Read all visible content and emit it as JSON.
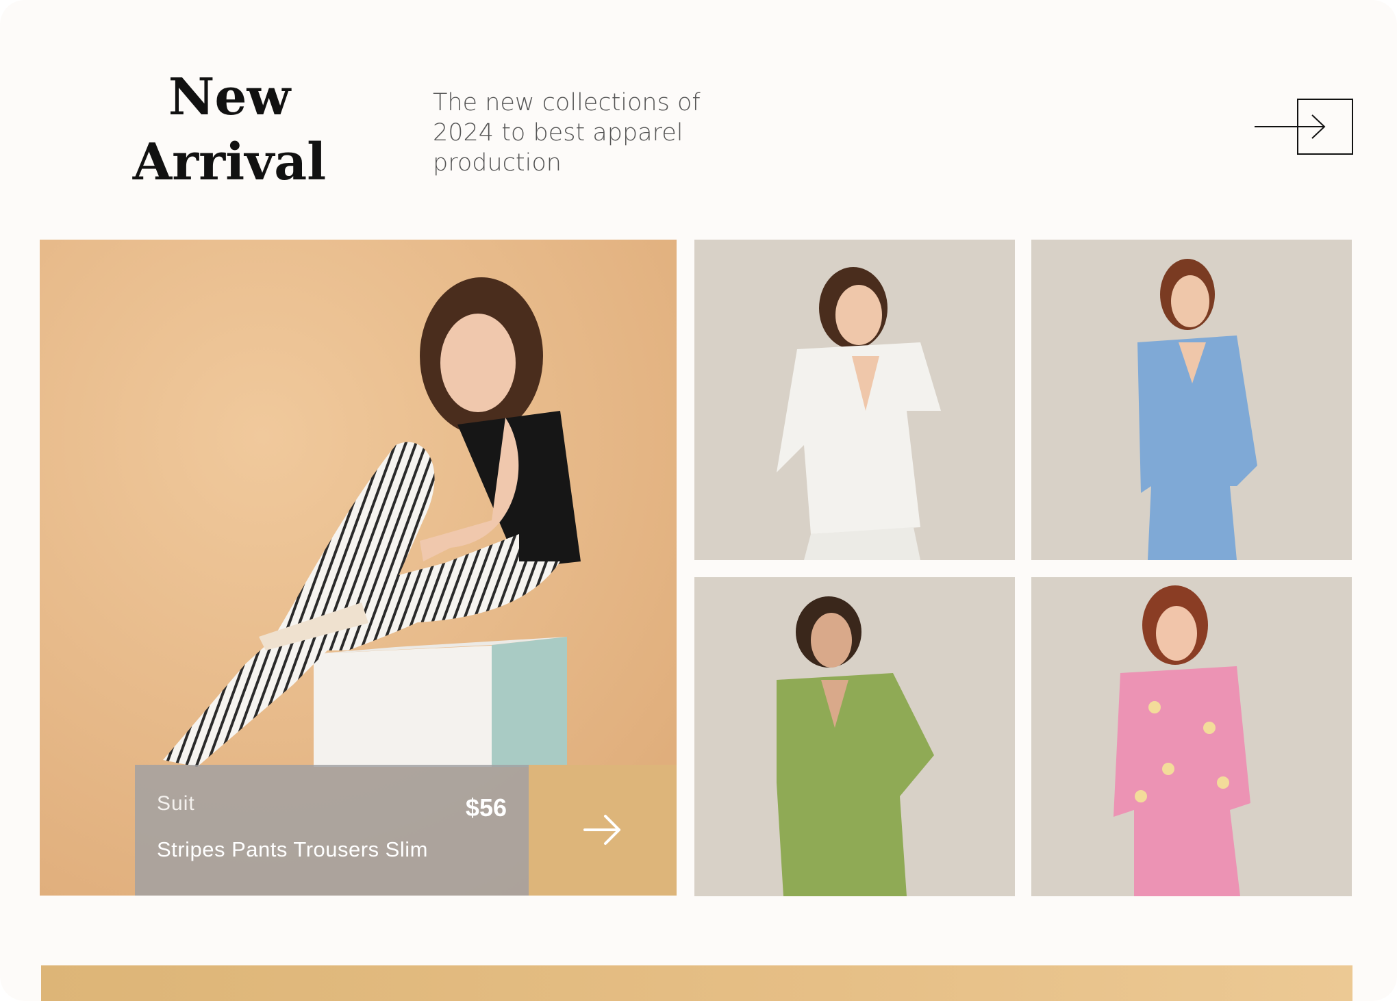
{
  "header": {
    "title": "New Arrival",
    "subtitle": "The new collections of 2024 to best apparel production",
    "view_all_icon": "arrow-right-icon"
  },
  "featured": {
    "category": "Suit",
    "price": "$56",
    "name": "Stripes Pants Trousers Slim",
    "go_icon": "arrow-right-icon",
    "background_color": "#e8b989"
  },
  "products": [
    {
      "outfit": "white blazer suit",
      "color": "#f3f2ee"
    },
    {
      "outfit": "blue blazer suit",
      "color": "#7fa9d6"
    },
    {
      "outfit": "green blazer suit",
      "color": "#8faa55"
    },
    {
      "outfit": "pink floral blazer suit",
      "color": "#ec93b4"
    }
  ],
  "colors": {
    "accent": "#ddb57a",
    "tile_background": "#d8d1c7",
    "page_background": "#fdfbf9"
  }
}
